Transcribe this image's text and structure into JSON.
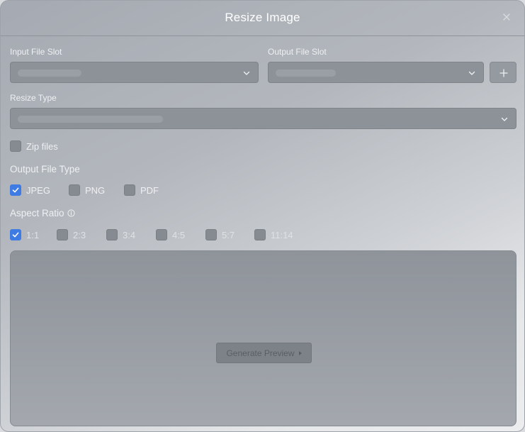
{
  "dialog": {
    "title": "Resize Image",
    "close_icon": "close-icon"
  },
  "input_file_slot": {
    "label": "Input File Slot",
    "value": "",
    "icon": "chevron-down-icon"
  },
  "output_file_slot": {
    "label": "Output File Slot",
    "value": "",
    "icon": "chevron-down-icon",
    "add_icon": "plus-icon"
  },
  "resize_type": {
    "label": "Resize Type",
    "value": "",
    "icon": "chevron-down-icon"
  },
  "zip_files": {
    "label": "Zip files",
    "checked": false
  },
  "output_file_type": {
    "label": "Output File Type",
    "options": [
      {
        "label": "JPEG",
        "checked": true
      },
      {
        "label": "PNG",
        "checked": false
      },
      {
        "label": "PDF",
        "checked": false
      }
    ]
  },
  "aspect_ratio": {
    "label": "Aspect Ratio",
    "info_icon": "info-icon",
    "options": [
      {
        "label": "1:1",
        "checked": true
      },
      {
        "label": "2:3",
        "checked": false
      },
      {
        "label": "3:4",
        "checked": false
      },
      {
        "label": "4:5",
        "checked": false
      },
      {
        "label": "5:7",
        "checked": false
      },
      {
        "label": "11:14",
        "checked": false
      }
    ]
  },
  "preview": {
    "button_label": "Generate Preview",
    "button_icon": "play-icon"
  },
  "colors": {
    "accent": "#3e7be3",
    "title_text": "#ffffff"
  }
}
